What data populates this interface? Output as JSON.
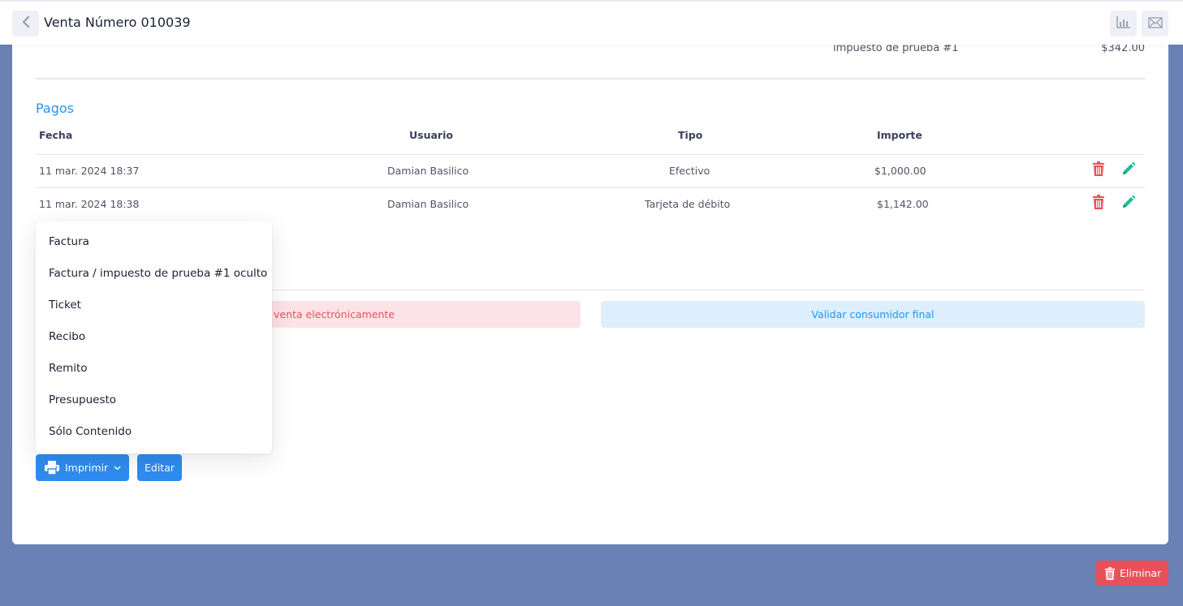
{
  "header": {
    "title": "Venta Número 010039"
  },
  "summary": {
    "tax_label": "impuesto de prueba #1",
    "tax_value": "$342.00"
  },
  "payments": {
    "title": "Pagos",
    "columns": [
      "Fecha",
      "Usuario",
      "Tipo",
      "Importe"
    ],
    "rows": [
      {
        "fecha": "11 mar. 2024 18:37",
        "usuario": "Damian Basilico",
        "tipo": "Efectivo",
        "importe": "$1,000.00"
      },
      {
        "fecha": "11 mar. 2024 18:38",
        "usuario": "Damian Basilico",
        "tipo": "Tarjeta de débito",
        "importe": "$1,142.00"
      }
    ]
  },
  "alerts": {
    "invoice_partial": "venta electrónicamente",
    "validate_consumer": "Validar consumidor final"
  },
  "print_menu": {
    "items": [
      "Factura",
      "Factura / impuesto de prueba #1 oculto",
      "Ticket",
      "Recibo",
      "Remito",
      "Presupuesto",
      "Sólo Contenido"
    ]
  },
  "actions": {
    "print_label": "Imprimir",
    "edit_label": "Editar",
    "delete_label": "Eliminar"
  },
  "colors": {
    "page_bg": "#6981b4",
    "accent_blue": "#2196f3",
    "primary_button": "#2f8cef",
    "danger": "#e7515a",
    "edit_green": "#1abc9c"
  },
  "icons": {
    "back": "chevron-left-icon",
    "stats": "bar-chart-icon",
    "mail": "envelope-icon",
    "delete": "trash-icon",
    "edit": "pencil-icon",
    "print": "printer-icon",
    "caret": "chevron-down-icon"
  }
}
